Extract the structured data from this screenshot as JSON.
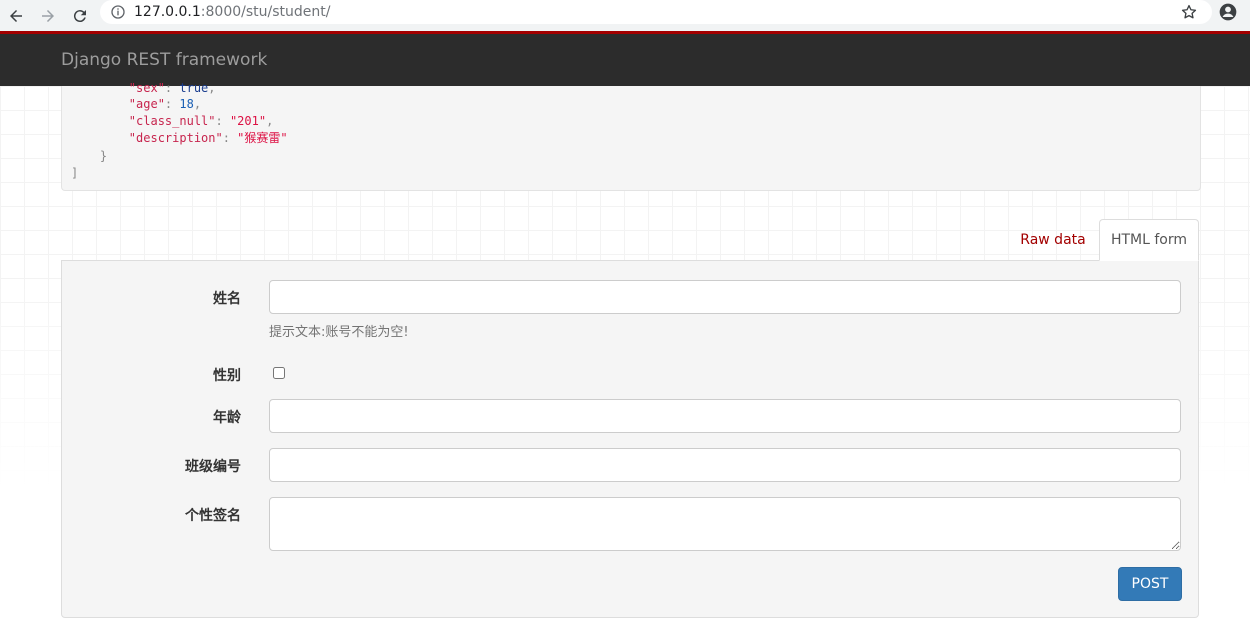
{
  "browser": {
    "url_host": "127.0.0.1",
    "url_path": ":8000/stu/student/"
  },
  "navbar": {
    "brand": "Django REST framework"
  },
  "response": {
    "lines": [
      {
        "key": "\"sex\"",
        "sep": ": ",
        "value": "true",
        "trail": ","
      },
      {
        "key": "\"age\"",
        "sep": ": ",
        "value": "18",
        "trail": ","
      },
      {
        "key": "\"class_null\"",
        "sep": ": ",
        "value": "\"201\"",
        "trail": ","
      },
      {
        "key": "\"description\"",
        "sep": ": ",
        "value": "\"猴赛雷\"",
        "trail": ""
      }
    ],
    "close_brace": "}",
    "close_bracket": "]"
  },
  "tabs": {
    "raw": "Raw data",
    "html": "HTML form"
  },
  "form": {
    "name_label": "姓名",
    "name_help": "提示文本:账号不能为空!",
    "sex_label": "性别",
    "age_label": "年龄",
    "class_label": "班级编号",
    "description_label": "个性签名",
    "post_label": "POST"
  }
}
